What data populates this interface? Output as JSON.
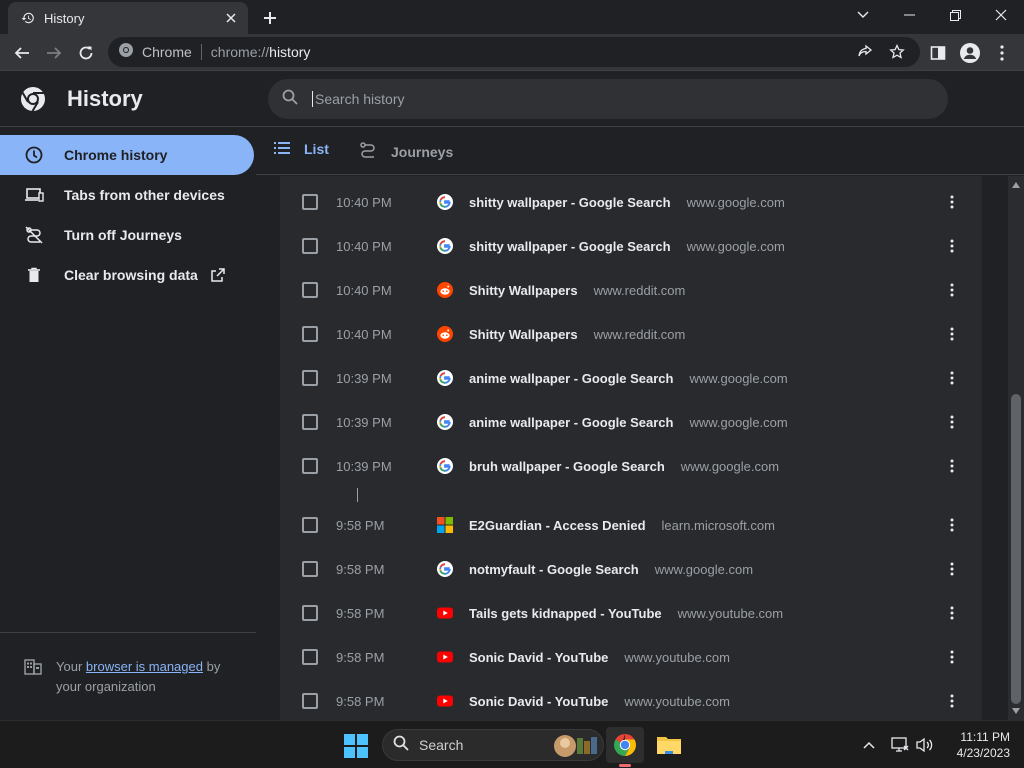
{
  "browser": {
    "tab_title": "History",
    "new_tab_symbol": "+",
    "omnibox_site": "Chrome",
    "omnibox_scheme": "chrome://",
    "omnibox_path": "history"
  },
  "page": {
    "title": "History",
    "search_placeholder": "Search history"
  },
  "sidebar": {
    "items": [
      {
        "label": "Chrome history",
        "icon": "clock-icon",
        "active": true
      },
      {
        "label": "Tabs from other devices",
        "icon": "devices-icon",
        "active": false
      },
      {
        "label": "Turn off Journeys",
        "icon": "journeys-off-icon",
        "active": false
      },
      {
        "label": "Clear browsing data",
        "icon": "trash-icon",
        "active": false
      }
    ],
    "managed_prefix": "Your",
    "managed_link": "browser is managed",
    "managed_suffix": "by",
    "managed_line2": "your organization"
  },
  "view_tabs": {
    "list_label": "List",
    "journeys_label": "Journeys",
    "active": "List"
  },
  "history": [
    {
      "time": "10:40 PM",
      "title": "shitty wallpaper - Google Search",
      "domain": "www.google.com",
      "favicon": "google-icon"
    },
    {
      "time": "10:40 PM",
      "title": "shitty wallpaper - Google Search",
      "domain": "www.google.com",
      "favicon": "google-icon"
    },
    {
      "time": "10:40 PM",
      "title": "Shitty Wallpapers",
      "domain": "www.reddit.com",
      "favicon": "reddit-icon"
    },
    {
      "time": "10:40 PM",
      "title": "Shitty Wallpapers",
      "domain": "www.reddit.com",
      "favicon": "reddit-icon"
    },
    {
      "time": "10:39 PM",
      "title": "anime wallpaper - Google Search",
      "domain": "www.google.com",
      "favicon": "google-icon"
    },
    {
      "time": "10:39 PM",
      "title": "anime wallpaper - Google Search",
      "domain": "www.google.com",
      "favicon": "google-icon"
    },
    {
      "time": "10:39 PM",
      "title": "bruh wallpaper - Google Search",
      "domain": "www.google.com",
      "favicon": "google-icon"
    },
    {
      "time": "9:58 PM",
      "title": "E2Guardian - Access Denied",
      "domain": "learn.microsoft.com",
      "favicon": "microsoft-icon"
    },
    {
      "time": "9:58 PM",
      "title": "notmyfault - Google Search",
      "domain": "www.google.com",
      "favicon": "google-icon"
    },
    {
      "time": "9:58 PM",
      "title": "Tails gets kidnapped - YouTube",
      "domain": "www.youtube.com",
      "favicon": "youtube-icon"
    },
    {
      "time": "9:58 PM",
      "title": "Sonic David - YouTube",
      "domain": "www.youtube.com",
      "favicon": "youtube-icon"
    },
    {
      "time": "9:58 PM",
      "title": "Sonic David - YouTube",
      "domain": "www.youtube.com",
      "favicon": "youtube-icon"
    }
  ],
  "taskbar": {
    "search_label": "Search",
    "time": "11:11 PM",
    "date": "4/23/2023"
  },
  "colors": {
    "accent": "#8ab4f8",
    "background": "#202124",
    "card": "#292a2d",
    "toolbar": "#35363a"
  }
}
